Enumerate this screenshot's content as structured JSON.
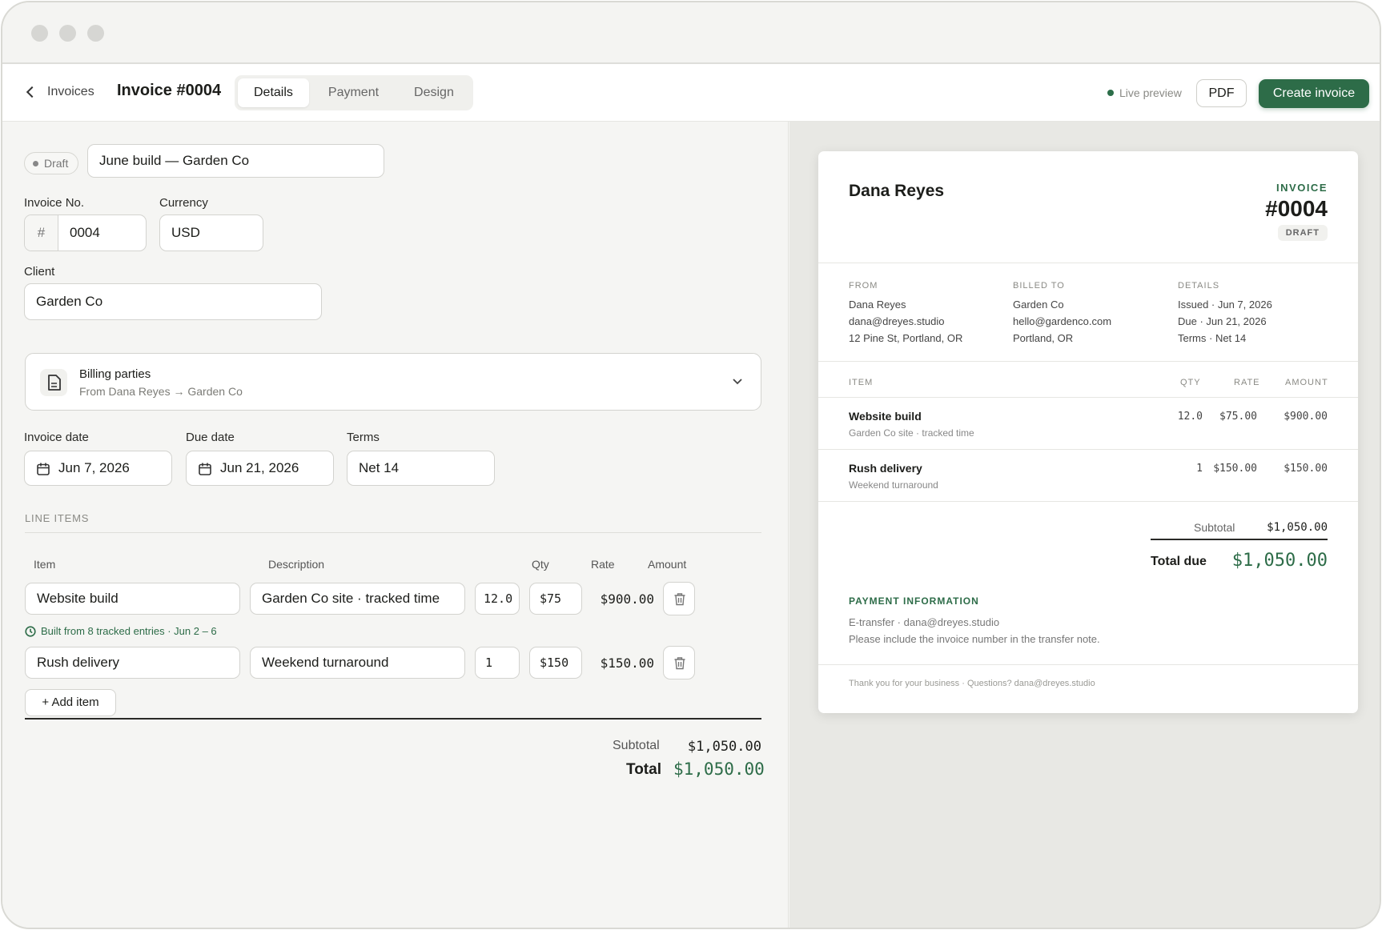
{
  "header": {
    "back_label": "Invoices",
    "invoice_title": "Invoice #0004",
    "tabs": [
      {
        "label": "Details",
        "active": true
      },
      {
        "label": "Payment",
        "active": false
      },
      {
        "label": "Design",
        "active": false
      }
    ],
    "live_preview": "Live preview",
    "pdf_label": "PDF",
    "create_label": "Create invoice"
  },
  "form": {
    "status": "Draft",
    "name_value": "June build — Garden Co",
    "invoice_no_label": "Invoice No.",
    "invoice_no_prefix": "#",
    "invoice_no_value": "0004",
    "currency_label": "Currency",
    "currency_value": "USD",
    "client_label": "Client",
    "client_value": "Garden Co",
    "billing": {
      "title": "Billing parties",
      "subtitle": "From Dana Reyes → Garden Co"
    },
    "invoice_date_label": "Invoice date",
    "invoice_date_value": "Jun 7, 2026",
    "due_date_label": "Due date",
    "due_date_value": "Jun 21, 2026",
    "terms_label": "Terms",
    "terms_value": "Net 14"
  },
  "line_items": {
    "section_title": "LINE ITEMS",
    "headers": {
      "item": "Item",
      "description": "Description",
      "qty": "Qty",
      "rate": "Rate",
      "amount": "Amount"
    },
    "rows": [
      {
        "item": "Website build",
        "description": "Garden Co site · tracked time",
        "qty": "12.0",
        "rate": "$75",
        "amount": "$900.00",
        "note": "Built from 8 tracked entries · Jun 2 – 6"
      },
      {
        "item": "Rush delivery",
        "description": "Weekend turnaround",
        "qty": "1",
        "rate": "$150",
        "amount": "$150.00"
      }
    ],
    "add_label": "+ Add item",
    "subtotal_label": "Subtotal",
    "subtotal_value": "$1,050.00",
    "total_label": "Total",
    "total_value": "$1,050.00"
  },
  "preview": {
    "name": "Dana Reyes",
    "invoice_label": "INVOICE",
    "invoice_number": "#0004",
    "status": "DRAFT",
    "from": {
      "heading": "FROM",
      "lines": [
        "Dana Reyes",
        "dana@dreyes.studio",
        "12 Pine St, Portland, OR"
      ]
    },
    "billed_to": {
      "heading": "BILLED TO",
      "lines": [
        "Garden Co",
        "hello@gardenco.com",
        "Portland, OR"
      ]
    },
    "details": {
      "heading": "DETAILS",
      "lines": [
        "Issued · Jun 7, 2026",
        "Due · Jun 21, 2026",
        "Terms · Net 14"
      ]
    },
    "table_headers": {
      "item": "ITEM",
      "qty": "QTY",
      "rate": "RATE",
      "amount": "AMOUNT"
    },
    "rows": [
      {
        "item": "Website build",
        "description": "Garden Co site · tracked time",
        "qty": "12.0",
        "rate": "$75.00",
        "amount": "$900.00"
      },
      {
        "item": "Rush delivery",
        "description": "Weekend turnaround",
        "qty": "1",
        "rate": "$150.00",
        "amount": "$150.00"
      }
    ],
    "subtotal_label": "Subtotal",
    "subtotal_value": "$1,050.00",
    "total_label": "Total due",
    "total_value": "$1,050.00",
    "payment_heading": "PAYMENT INFORMATION",
    "payment_line1": "E-transfer · dana@dreyes.studio",
    "payment_line2": "Please include the invoice number in the transfer note.",
    "footer": "Thank you for your business · Questions? dana@dreyes.studio"
  },
  "colors": {
    "accent": "#2d6c48",
    "page_bg": "#f5f5f3",
    "preview_bg": "#e8e8e4"
  }
}
